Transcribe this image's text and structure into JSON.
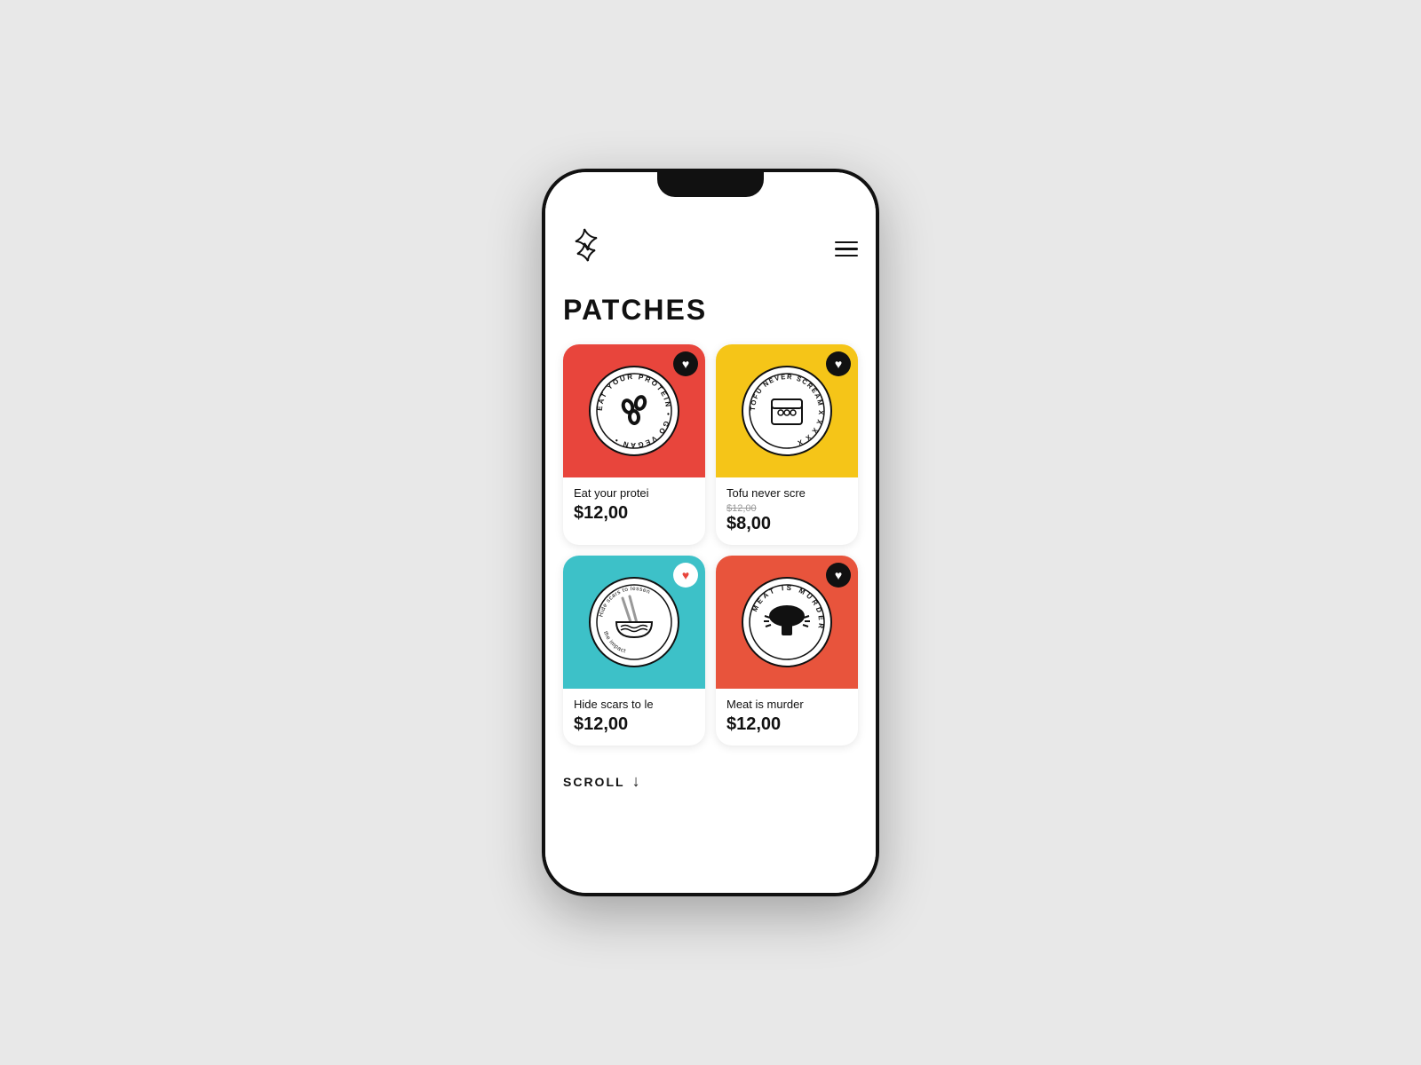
{
  "app": {
    "title": "PATCHES"
  },
  "header": {
    "menu_label": "menu"
  },
  "patches": [
    {
      "id": "eat-your-protein",
      "name": "Eat your protei",
      "price": "$12,00",
      "original_price": null,
      "color": "red",
      "badge_text": "EAT YOUR PROTEIN • GO VEGAN",
      "favorited": true,
      "favorite_style": "dark"
    },
    {
      "id": "tofu-never-scream",
      "name": "Tofu never scre",
      "price": "$8,00",
      "original_price": "$12,00",
      "color": "yellow",
      "badge_text": "TOFU NEVER SCREAM X X X X X",
      "favorited": true,
      "favorite_style": "dark"
    },
    {
      "id": "hide-scars",
      "name": "Hide scars to le",
      "price": "$12,00",
      "original_price": null,
      "color": "teal",
      "badge_text": "Hide scars to lessen the impact",
      "favorited": true,
      "favorite_style": "light"
    },
    {
      "id": "meat-is-murder",
      "name": "Meat is murder",
      "price": "$12,00",
      "original_price": null,
      "color": "orange",
      "badge_text": "MEAT IS MURDER",
      "favorited": true,
      "favorite_style": "dark"
    }
  ],
  "scroll": {
    "label": "SCROLL",
    "arrow": "↓"
  }
}
